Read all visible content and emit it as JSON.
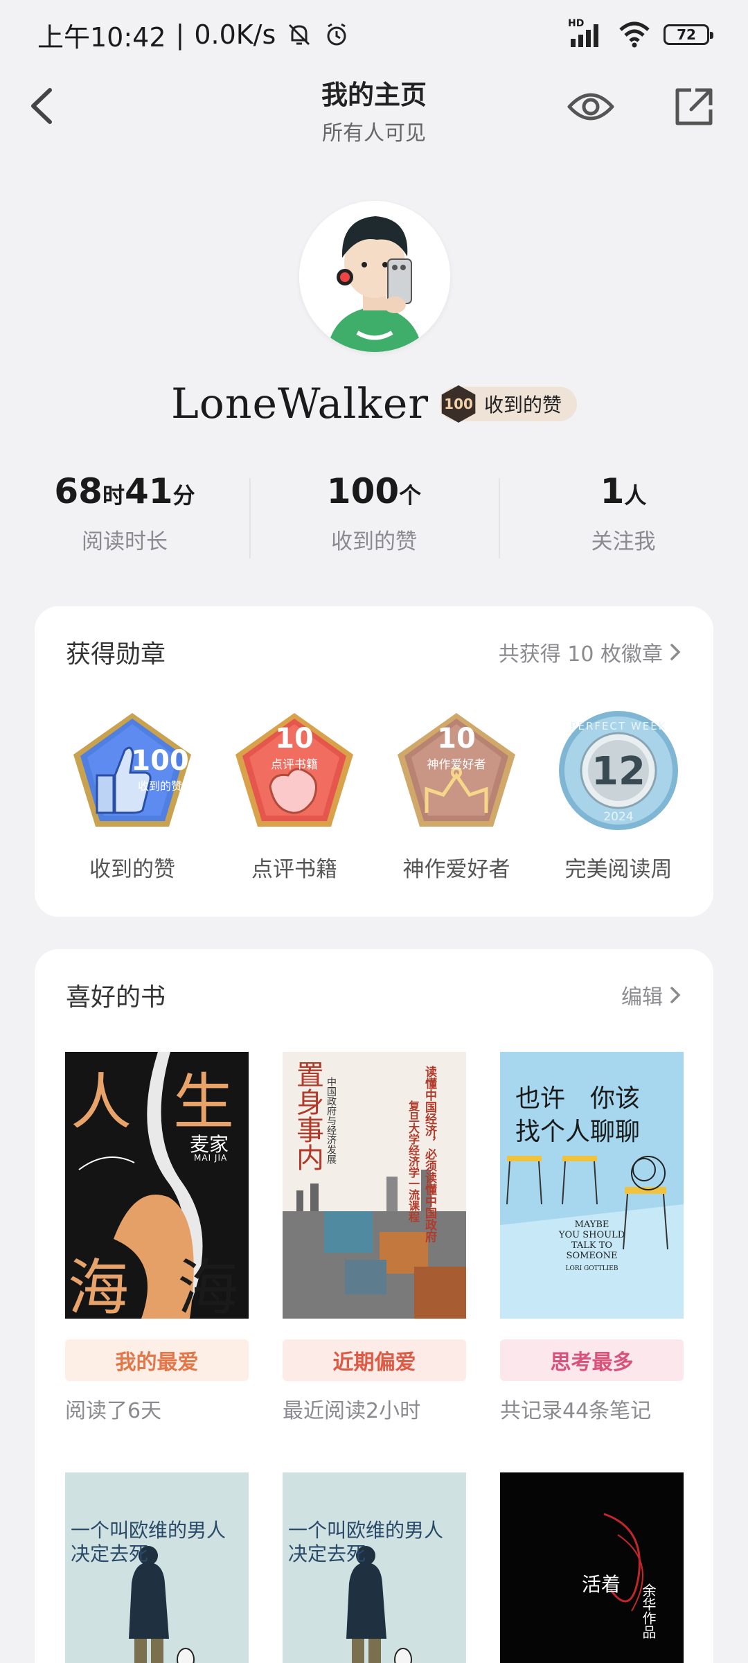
{
  "status": {
    "time": "上午10:42",
    "sep": "|",
    "speed": "0.0K/s",
    "network": "HD",
    "battery": "72"
  },
  "nav": {
    "title": "我的主页",
    "subtitle": "所有人可见"
  },
  "profile": {
    "username": "LoneWalker",
    "badge_count": "100",
    "badge_label": "收到的赞"
  },
  "stats": [
    {
      "n1": "68",
      "u1": "时",
      "n2": "41",
      "u2": "分",
      "label": "阅读时长"
    },
    {
      "n1": "100",
      "u1": "个",
      "n2": "",
      "u2": "",
      "label": "收到的赞"
    },
    {
      "n1": "1",
      "u1": "人",
      "n2": "",
      "u2": "",
      "label": "关注我"
    }
  ],
  "medals": {
    "title": "获得勋章",
    "link": "共获得 10 枚徽章",
    "items": [
      {
        "label": "收到的赞",
        "num": "100",
        "inner": "收到的赞"
      },
      {
        "label": "点评书籍",
        "num": "10",
        "inner": "点评书籍"
      },
      {
        "label": "神作爱好者",
        "num": "10",
        "inner": "神作爱好者"
      },
      {
        "label": "完美阅读周",
        "num": "12",
        "ring_top": "PERFECT WEEK",
        "ring_bottom": "2024"
      }
    ]
  },
  "books": {
    "title": "喜好的书",
    "link": "编辑",
    "items": [
      {
        "tag": "我的最爱",
        "sub": "阅读了6天",
        "cover": {
          "t1": "人",
          "t2": "生",
          "t3": "海",
          "t4": "海",
          "author": "麦家",
          "author_en": "MAI JIA"
        }
      },
      {
        "tag": "近期偏爱",
        "sub": "最近阅读2小时",
        "cover": {
          "t1": "置身事内",
          "side": "中国政府与经济发展",
          "quote": "读懂中国经济，必须读懂中国政府",
          "quote2": "复旦大学经济学一流课程"
        }
      },
      {
        "tag": "思考最多",
        "sub": "共记录44条笔记",
        "cover": {
          "t1": "也许　你该",
          "t2": "找个人聊聊",
          "en1": "MAYBE",
          "en2": "YOU SHOULD",
          "en3": "TALK TO",
          "en4": "SOMEONE",
          "author": "LORI GOTTLIEB"
        }
      }
    ],
    "more": [
      {
        "cover": {
          "t1": "一个叫欧维的男人",
          "t2": "决定去死"
        }
      },
      {
        "cover": {
          "t1": "一个叫欧维的男人",
          "t2": "决定去死"
        }
      },
      {
        "cover": {
          "t1": "活着",
          "t2": "余华作品"
        }
      }
    ]
  },
  "colors": {
    "tag_orange_bg": "#fdeee6",
    "tag_orange_fg": "#e2774a",
    "tag_red_bg": "#fdebe7",
    "tag_red_fg": "#dd5a44",
    "tag_pink_bg": "#fce7ec",
    "tag_pink_fg": "#d9527a"
  }
}
